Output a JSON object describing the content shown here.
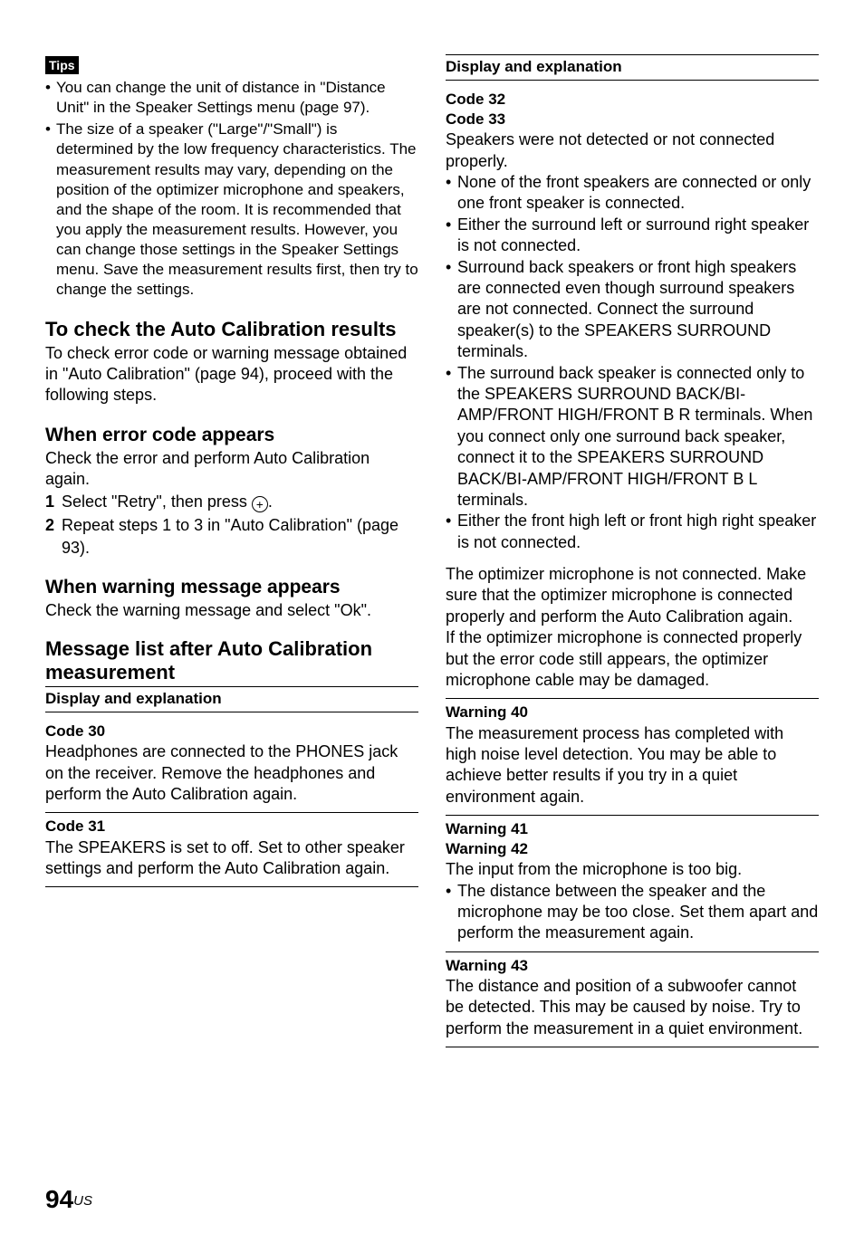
{
  "left": {
    "tips_label": "Tips",
    "tips": [
      "You can change the unit of distance in \"Distance Unit\" in the Speaker Settings menu (page 97).",
      "The size of a speaker (\"Large\"/\"Small\") is determined by the low frequency characteristics. The measurement results may vary, depending on the position of the optimizer microphone and speakers, and the shape of the room. It is recommended that you apply the measurement results. However, you can change those settings in the Speaker Settings menu. Save the measurement results first, then try to change the settings."
    ],
    "check_title": "To check the Auto Calibration results",
    "check_body": "To check error code or warning message obtained in \"Auto Calibration\" (page 94), proceed with the following steps.",
    "error_title": "When error code appears",
    "error_body": "Check the error and perform Auto Calibration again.",
    "step1_pre": "Select \"Retry\", then press ",
    "step1_post": ".",
    "step2": "Repeat steps 1 to 3 in \"Auto Calibration\" (page 93).",
    "warn_title": "When warning message appears",
    "warn_body": "Check the warning message and select \"Ok\".",
    "msg_title": "Message list after Auto Calibration measurement",
    "de_header": "Display and explanation",
    "code30_title": "Code 30",
    "code30_body": "Headphones are connected to the PHONES jack on the receiver. Remove the headphones and perform the Auto Calibration again.",
    "code31_title": "Code 31",
    "code31_body": "The SPEAKERS is set to off. Set to other speaker settings and perform the Auto Calibration again."
  },
  "right": {
    "de_header": "Display and explanation",
    "code32_title1": "Code 32",
    "code32_title2": "Code 33",
    "code32_intro": "Speakers were not detected or not connected properly.",
    "code32_bullets": [
      "None of the front speakers are connected or only one front speaker is connected.",
      "Either the surround left or surround right speaker is not connected.",
      "Surround back speakers or front high speakers are connected even though surround speakers are not connected. Connect the surround speaker(s) to the SPEAKERS SURROUND terminals.",
      "The surround back speaker is connected only to the SPEAKERS SURROUND BACK/BI-AMP/FRONT HIGH/FRONT B R terminals. When you connect only one surround back speaker, connect it to the SPEAKERS SURROUND BACK/BI-AMP/FRONT HIGH/FRONT B L terminals.",
      "Either the front high left or front high right speaker is not connected."
    ],
    "code33_p1": "The optimizer microphone is not connected. Make sure that the optimizer microphone is connected properly and perform the Auto Calibration again.",
    "code33_p2": "If the optimizer microphone is connected properly but the error code still appears, the optimizer microphone cable may be damaged.",
    "w40_title": "Warning 40",
    "w40_body": "The measurement process has completed with high noise level detection. You may be able to achieve better results if you try in a quiet environment again.",
    "w41_title1": "Warning 41",
    "w41_title2": "Warning 42",
    "w41_intro": "The input from the microphone is too big.",
    "w41_bullets": [
      "The distance between the speaker and the microphone may be too close. Set them apart and perform the measurement again."
    ],
    "w43_title": "Warning 43",
    "w43_body": "The distance and position of a subwoofer cannot be detected. This may be caused by noise. Try to perform the measurement in a quiet environment."
  },
  "page_number": "94",
  "page_region": "US"
}
